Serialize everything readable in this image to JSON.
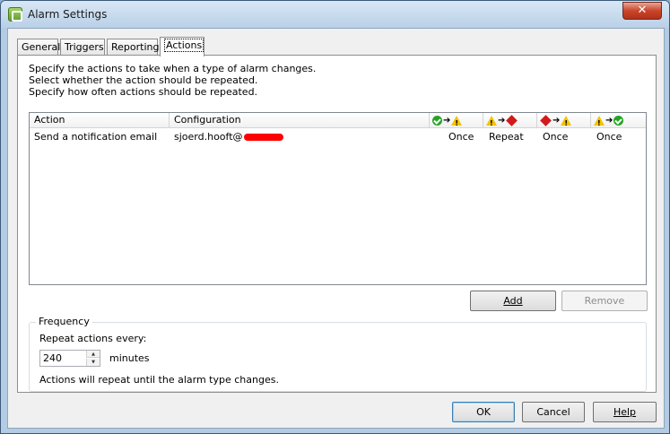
{
  "window": {
    "title": "Alarm Settings",
    "close_glyph": "✕"
  },
  "tabs": [
    {
      "label": "General"
    },
    {
      "label": "Triggers"
    },
    {
      "label": "Reporting"
    },
    {
      "label": "Actions",
      "active": true
    }
  ],
  "description": {
    "line1": "Specify the actions to take when a type of alarm changes.",
    "line2": "Select whether the action should be repeated.",
    "line3": "Specify how often actions should be repeated."
  },
  "grid": {
    "columns": {
      "action": "Action",
      "configuration": "Configuration",
      "transitions": [
        {
          "from": "ok-icon",
          "to": "warning-icon"
        },
        {
          "from": "warning-icon",
          "to": "critical-icon"
        },
        {
          "from": "critical-icon",
          "to": "warning-icon"
        },
        {
          "from": "warning-icon",
          "to": "ok-icon"
        }
      ]
    },
    "rows": [
      {
        "action": "Send a notification email",
        "configuration": "sjoerd.hooft@",
        "t1": "Once",
        "t2": "Repeat",
        "t3": "Once",
        "t4": "Once"
      }
    ]
  },
  "buttons": {
    "add": "Add",
    "remove": "Remove",
    "ok": "OK",
    "cancel": "Cancel",
    "help": "Help"
  },
  "frequency": {
    "title": "Frequency",
    "repeat_label": "Repeat actions every:",
    "value": "240",
    "unit": "minutes",
    "note": "Actions will repeat until the alarm type changes."
  },
  "colors": {
    "ok": "#26a326",
    "warning": "#f2c400",
    "critical": "#d11a1a"
  }
}
